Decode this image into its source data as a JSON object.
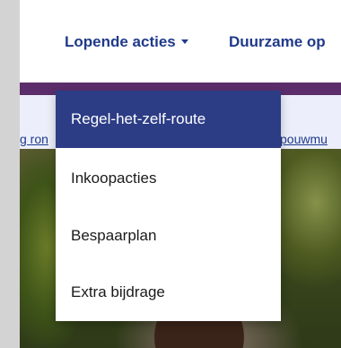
{
  "navbar": {
    "items": [
      {
        "label": "Lopende acties",
        "has_dropdown": true
      },
      {
        "label": "Duurzame op"
      }
    ]
  },
  "banner": {
    "left_link": "g ron",
    "right_link": "pouwmu"
  },
  "dropdown": {
    "items": [
      {
        "label": "Regel-het-zelf-route",
        "active": true
      },
      {
        "label": "Inkoopacties"
      },
      {
        "label": "Bespaarplan"
      },
      {
        "label": "Extra bijdrage"
      }
    ]
  },
  "colors": {
    "nav_text": "#1f3a8a",
    "accent_bar": "#5b2d6b",
    "active_item_bg": "#2c3d85",
    "banner_bg": "#eceffb"
  }
}
